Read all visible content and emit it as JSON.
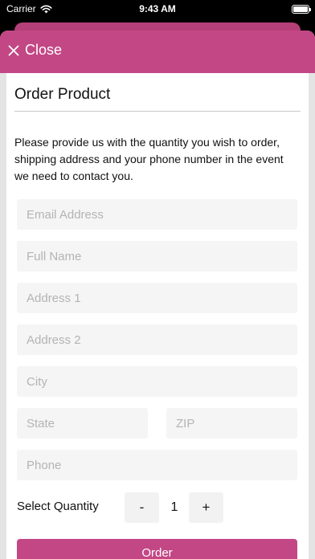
{
  "status_bar": {
    "carrier": "Carrier",
    "time": "9:43 AM",
    "wifi_icon": "wifi-icon",
    "battery_icon": "battery-icon",
    "battery_level": 1.0
  },
  "header": {
    "close_label": "Close",
    "close_icon": "close-icon"
  },
  "page": {
    "title": "Order Product",
    "intro": "Please provide us with the quantity you wish to order, shipping address and your phone number in the event we need to contact you."
  },
  "form": {
    "email": {
      "placeholder": "Email Address",
      "value": ""
    },
    "full_name": {
      "placeholder": "Full Name",
      "value": ""
    },
    "address1": {
      "placeholder": "Address 1",
      "value": ""
    },
    "address2": {
      "placeholder": "Address 2",
      "value": ""
    },
    "city": {
      "placeholder": "City",
      "value": ""
    },
    "state": {
      "placeholder": "State",
      "value": ""
    },
    "zip": {
      "placeholder": "ZIP",
      "value": ""
    },
    "phone": {
      "placeholder": "Phone",
      "value": ""
    }
  },
  "quantity": {
    "label": "Select Quantity",
    "decrement": "-",
    "value": "1",
    "increment": "+"
  },
  "order_button_label": "Order",
  "colors": {
    "accent": "#c34785",
    "header_back": "#b53f78",
    "field_bg": "#f5f5f5",
    "placeholder": "#b4b4b4"
  }
}
